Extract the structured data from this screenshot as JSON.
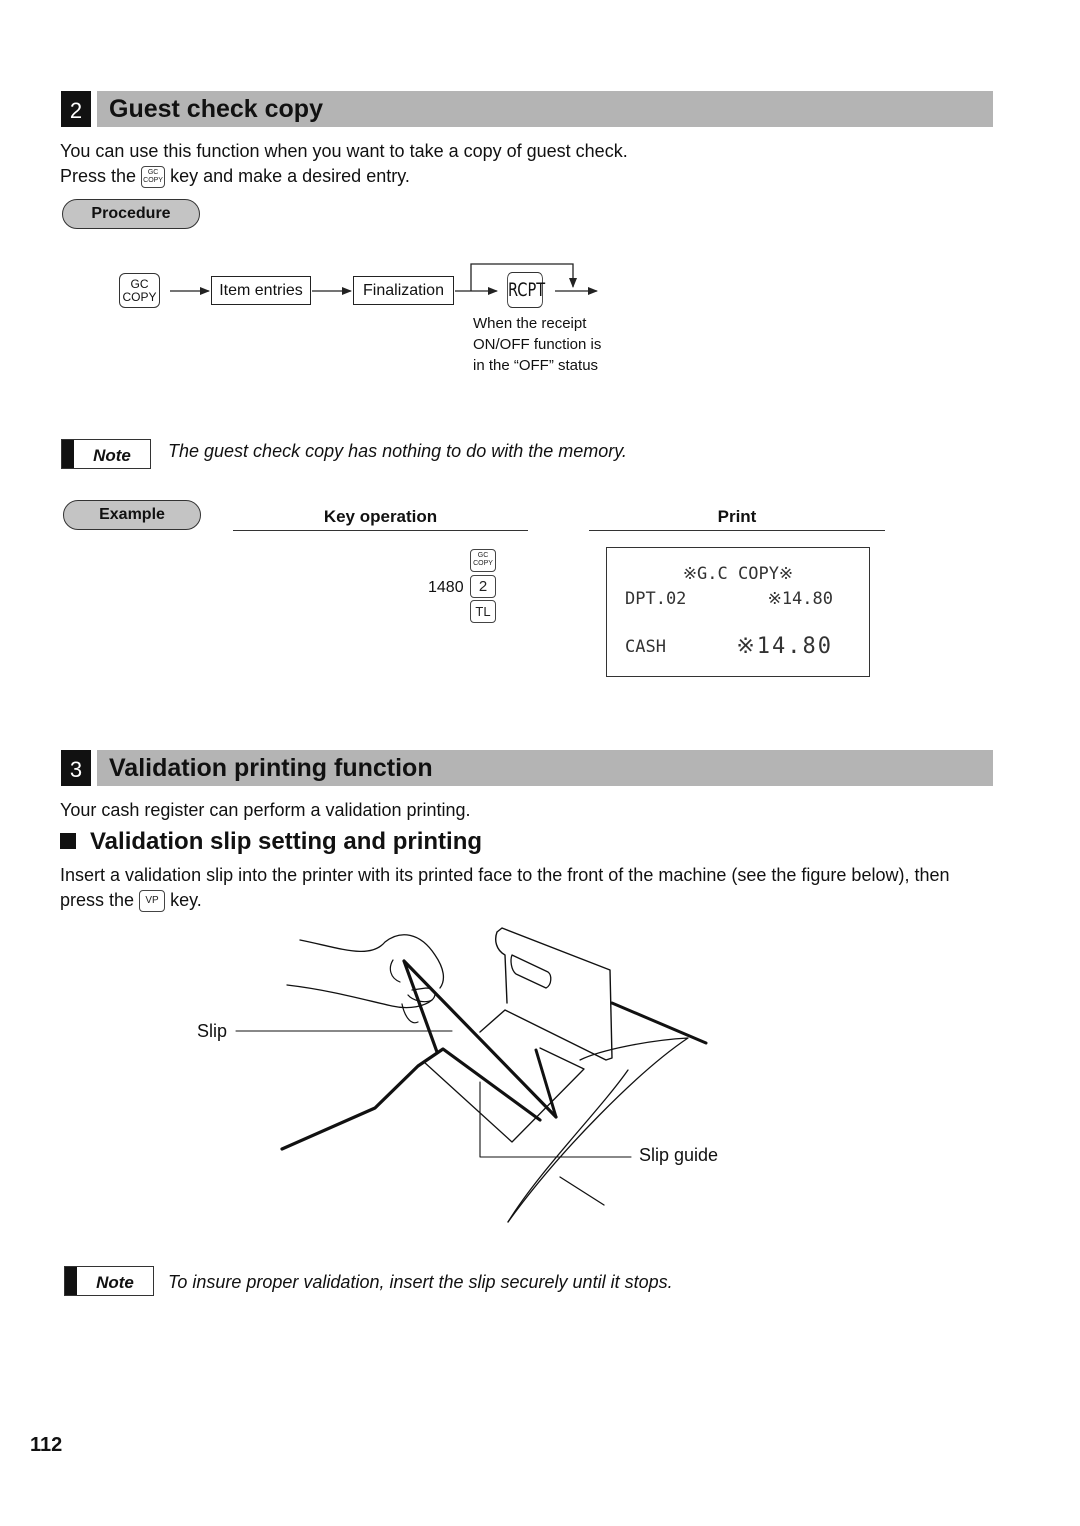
{
  "section2": {
    "number": "2",
    "title": "Guest check copy",
    "intro_line1": "You can use this function when you want to take a copy of guest check.",
    "intro_line2_pre": "Press the",
    "intro_line2_post": "key and make a desired entry.",
    "inline_key": {
      "top": "GC",
      "bottom": "COPY"
    },
    "procedure_label": "Procedure",
    "procedure_flow": {
      "start_key": {
        "top": "GC",
        "bottom": "COPY"
      },
      "steps": [
        "Item entries",
        "Finalization"
      ],
      "optional_key": "RCPT",
      "optional_note_lines": [
        "When the receipt",
        "ON/OFF function is",
        "in the “OFF” status"
      ]
    },
    "note": {
      "label": "Note",
      "text": "The guest check copy has nothing to do with the memory."
    },
    "example": {
      "label": "Example",
      "key_operation_header": "Key operation",
      "print_header": "Print",
      "key_operation": {
        "first_key": {
          "top": "GC",
          "bottom": "COPY"
        },
        "amount": "1480",
        "dept_key": "2",
        "total_key": "TL"
      },
      "receipt": {
        "title": "※G.C COPY※",
        "line_label": "DPT.02",
        "line_amount": "※14.80",
        "total_label": "CASH",
        "total_amount": "※14.80"
      }
    }
  },
  "section3": {
    "number": "3",
    "title": "Validation printing function",
    "intro": "Your cash register can perform a validation printing.",
    "subheading": "Validation slip setting and printing",
    "body_line1": "Insert a validation slip into the printer with its printed face to the front of the machine (see the figure below), then",
    "body_line2_pre": "press the",
    "body_line2_post": "key.",
    "inline_key": "VP",
    "figure": {
      "label_slip": "Slip",
      "label_slip_guide": "Slip guide"
    },
    "note": {
      "label": "Note",
      "text": "To insure proper validation, insert the slip securely until it stops."
    }
  },
  "page_number": "112"
}
